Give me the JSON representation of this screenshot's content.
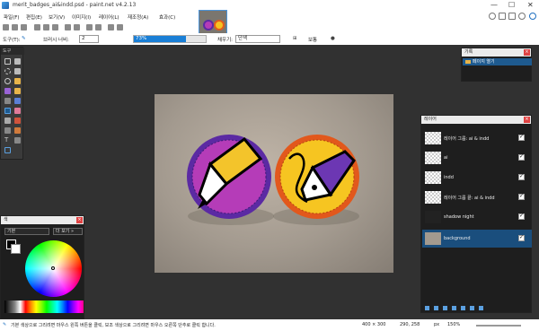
{
  "window": {
    "title": "merit_badges_ai&indd.psd - paint.net v4.2.13",
    "min": "—",
    "max": "☐",
    "close": "✕"
  },
  "menu": [
    "파일(F)",
    "편집(E)",
    "보기(V)",
    "이미지(I)",
    "레이어(L)",
    "재조정(A)",
    "효과(C)"
  ],
  "toolbar2": {
    "tool_label": "도구(T):",
    "brush_label": "브러시 너비:",
    "brush_value": "2",
    "opacity": "73%",
    "fill_label": "채우기:",
    "fill_value": "단색",
    "antialias": "보통",
    "brush_icon": "brush-icon"
  },
  "tools_panel": {
    "title": "도구"
  },
  "history": {
    "title": "기록",
    "items": [
      {
        "label": "페이지 열기"
      }
    ]
  },
  "layers": {
    "title": "레이어",
    "items": [
      {
        "name": "레이어 그룹: ai & indd",
        "selected": false
      },
      {
        "name": "ai",
        "selected": false
      },
      {
        "name": "indd",
        "selected": false
      },
      {
        "name": "레이어 그룹 끝: ai & indd",
        "selected": false
      },
      {
        "name": "shadow night",
        "selected": false
      },
      {
        "name": "background",
        "selected": true
      }
    ]
  },
  "colors": {
    "title": "색",
    "preset": "기본",
    "mode": "더 보기 »",
    "primary": "#000000",
    "secondary": "#ffffff"
  },
  "status": {
    "hint": "기본 색상으로 그리려면 마우스 왼쪽 버튼을 클릭, 보조 색상으로 그리려면 마우스 오른쪽 단추로 클릭 합니다.",
    "size": "400 × 300",
    "cursor": "290, 258",
    "unit": "px",
    "zoom": "150%"
  },
  "colors_accent": {
    "selection": "#1a4e7d",
    "fill": "#1a7fd6"
  }
}
